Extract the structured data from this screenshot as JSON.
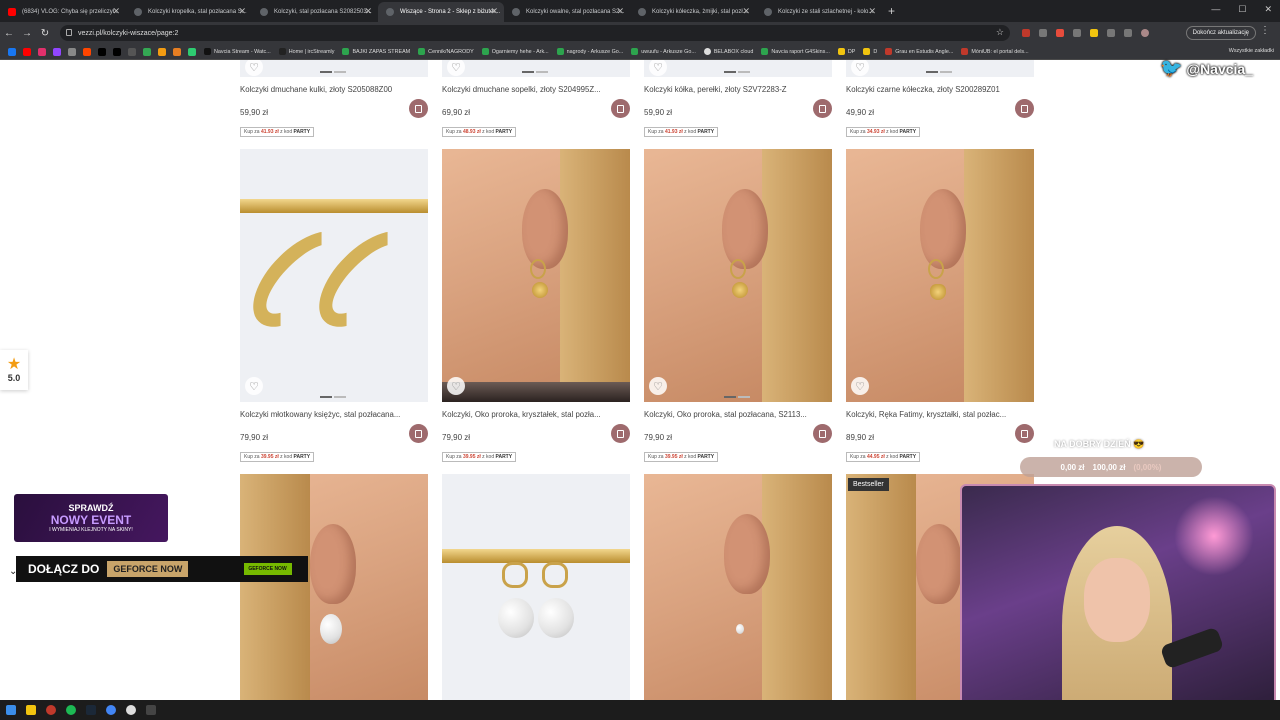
{
  "browser": {
    "tabs": [
      {
        "title": "(6834) VLOG: Chyba się przeliczył...",
        "active": false,
        "favicon": "youtube-icon"
      },
      {
        "title": "Kolczyki kropelka, stal pozłacana S...",
        "active": false,
        "favicon": "site-icon"
      },
      {
        "title": "Kolczyki, stal pozłacana S2082503...",
        "active": false,
        "favicon": "site-icon"
      },
      {
        "title": "Wiszące - Strona 2 - Sklep z biżuter...",
        "active": true,
        "favicon": "site-icon"
      },
      {
        "title": "Kolczyki owalne, stal pozłacana S2...",
        "active": false,
        "favicon": "site-icon"
      },
      {
        "title": "Kolczyki kółeczka, żmijki, stal pozł...",
        "active": false,
        "favicon": "site-icon"
      },
      {
        "title": "Kolczyki ze stali szlachetnej - kolo...",
        "active": false,
        "favicon": "site-icon"
      }
    ],
    "new_tab": "+",
    "url": "vezzi.pl/kolczyki-wiszace/page:2",
    "update_button": "Dokończ aktualizację",
    "bookmarks": [
      "Navcia Stream - Watc...",
      "Home | ircStreamly",
      "BAJKI ZAPAS STREAM",
      "Cennik/NAGRODY",
      "Ogarniemy hehe - Ark...",
      "nagrody - Arkusze Go...",
      "uwuufu - Arkusze Go...",
      "BELABOX cloud",
      "Navcia raport G4Skins...",
      "DP",
      "D",
      "Grau en Estudis Angle...",
      "MóniUB: el portal dels..."
    ],
    "all_bookmarks": "Wszystkie zakładki"
  },
  "products_top": [
    {
      "name": "Kolczyki dmuchane kulki, złoty S205088Z00",
      "price": "59,90 zł",
      "promo_price": "41.93 zł",
      "promo_code": "PARTY"
    },
    {
      "name": "Kolczyki dmuchane sopelki, złoty S204995Z...",
      "price": "69,90 zł",
      "promo_price": "48.93 zł",
      "promo_code": "PARTY"
    },
    {
      "name": "Kolczyki kółka, perełki, złoty S2V72283-Z",
      "price": "59,90 zł",
      "promo_price": "41.93 zł",
      "promo_code": "PARTY"
    },
    {
      "name": "Kolczyki czarne kółeczka, złoty S200289Z01",
      "price": "49,90 zł",
      "promo_price": "34.93 zł",
      "promo_code": "PARTY"
    }
  ],
  "products_mid": [
    {
      "name": "Kolczyki młotkowany księżyc, stal pozłacana...",
      "price": "79,90 zł",
      "promo_price": "39.95 zł",
      "promo_code": "PARTY"
    },
    {
      "name": "Kolczyki, Oko proroka, kryształek, stal pozła...",
      "price": "79,90 zł",
      "promo_price": "39.95 zł",
      "promo_code": "PARTY"
    },
    {
      "name": "Kolczyki, Oko proroka, stal pozłacana, S2113...",
      "price": "79,90 zł",
      "promo_price": "39.95 zł",
      "promo_code": "PARTY"
    },
    {
      "name": "Kolczyki, Ręka Fatimy, kryształki, stal pozłac...",
      "price": "89,90 zł",
      "promo_price": "44.95 zł",
      "promo_code": "PARTY"
    }
  ],
  "promo_prefix": "Kup za",
  "promo_mid": "z kod",
  "bestseller_badge": "Bestseller",
  "rating": {
    "value": "5.0"
  },
  "event_banner": {
    "line1": "SPRAWDŹ",
    "line2": "NOWY EVENT",
    "line3": "I WYMIENIAJ KLEJNOTY NA SKINY!"
  },
  "geforce_banner": {
    "text": "DOŁĄCZ DO",
    "brand": "GEFORCE NOW",
    "logo": "GEFORCE NOW"
  },
  "overlay": {
    "twitter_handle": "@Navcia_",
    "greeting": "NA DOBRY DZIEŃ 😎",
    "counter_current": "0,00 zł",
    "counter_goal": "100,00 zł",
    "counter_percent": "(0,00%)"
  }
}
